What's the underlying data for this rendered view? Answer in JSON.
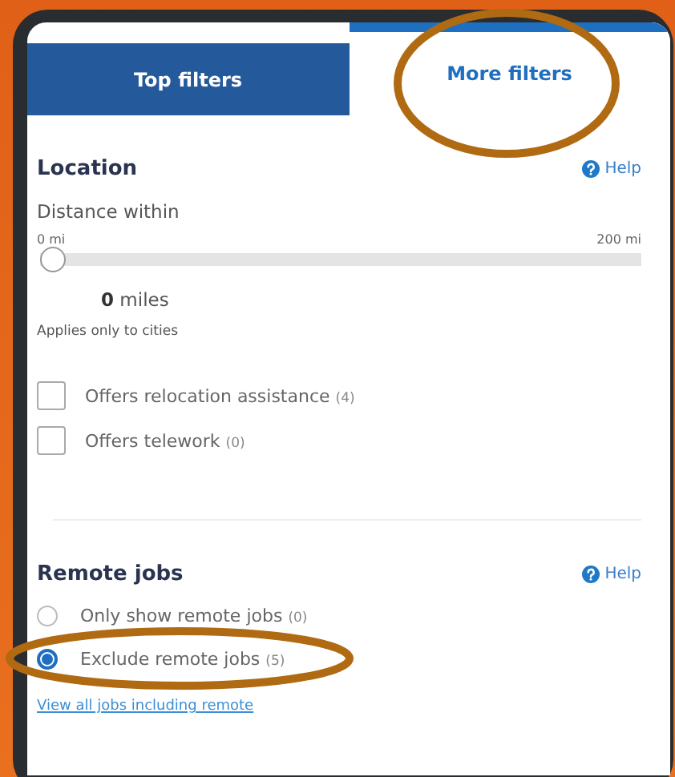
{
  "tabs": [
    {
      "label": "Top filters",
      "selected": false
    },
    {
      "label": "More filters",
      "selected": true
    }
  ],
  "location": {
    "title": "Location",
    "help": "Help",
    "distance_label": "Distance within",
    "min_label": "0 mi",
    "max_label": "200 mi",
    "level": 0,
    "value": "0",
    "unit": "miles",
    "note": "Applies only to cities",
    "options": [
      {
        "label": "Offers relocation assistance",
        "count": "(4)",
        "checked": false
      },
      {
        "label": "Offers telework",
        "count": "(0)",
        "checked": false
      }
    ]
  },
  "remote": {
    "title": "Remote jobs",
    "help": "Help",
    "options": [
      {
        "label": "Only show remote jobs",
        "count": "(0)",
        "selected": false
      },
      {
        "label": "Exclude remote jobs",
        "count": "(5)",
        "selected": true
      }
    ],
    "link": "View all jobs including remote"
  }
}
